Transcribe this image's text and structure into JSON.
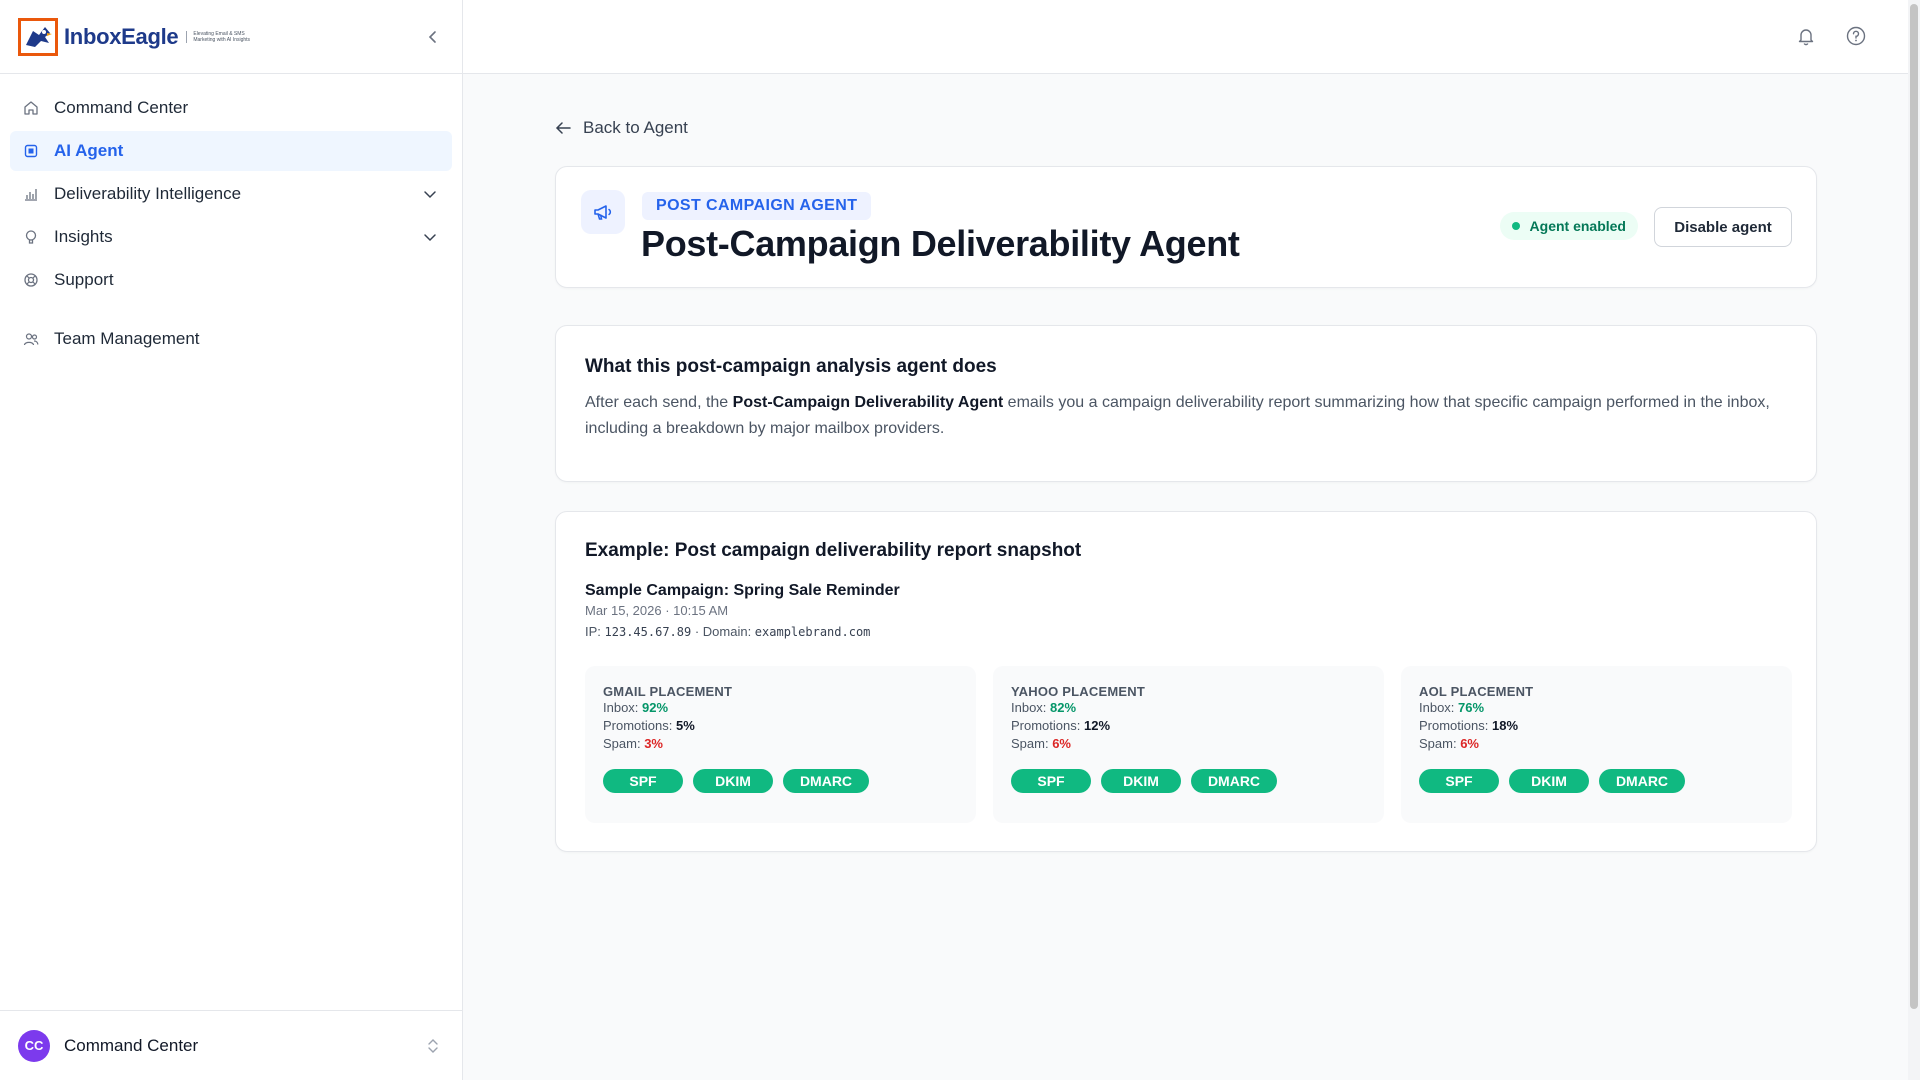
{
  "brand": {
    "name": "InboxEagle",
    "tagline": "Elevating Email & SMS Marketing with AI Insights"
  },
  "sidebar": {
    "items": [
      {
        "label": "Command Center",
        "icon": "home-icon"
      },
      {
        "label": "AI Agent",
        "icon": "chip-icon",
        "active": true
      },
      {
        "label": "Deliverability Intelligence",
        "icon": "bar-chart-icon",
        "expandable": true
      },
      {
        "label": "Insights",
        "icon": "lightbulb-icon",
        "expandable": true
      },
      {
        "label": "Support",
        "icon": "lifebuoy-icon"
      },
      {
        "label": "Team Management",
        "icon": "users-icon"
      }
    ],
    "footer": {
      "avatar_initials": "CC",
      "label": "Command Center"
    }
  },
  "main": {
    "back_label": "Back to Agent",
    "agent": {
      "tag": "POST CAMPAIGN AGENT",
      "title": "Post-Campaign Deliverability Agent",
      "status": "Agent enabled",
      "disable_label": "Disable agent"
    },
    "description": {
      "title": "What this post-campaign analysis agent does",
      "text_before": "After each send, the ",
      "text_bold": "Post-Campaign Deliverability Agent",
      "text_after": " emails you a campaign deliverability report summarizing how that specific campaign performed in the inbox, including a breakdown by major mailbox providers."
    },
    "example": {
      "title": "Example: Post campaign deliverability report snapshot",
      "campaign_name": "Sample Campaign: Spring Sale Reminder",
      "campaign_date": "Mar 15, 2026 · 10:15 AM",
      "ip_label": "IP: ",
      "ip_value": "123.45.67.89",
      "domain_label": " · Domain: ",
      "domain_value": "examplebrand.com",
      "placements": [
        {
          "title": "GMAIL PLACEMENT",
          "inbox": "92%",
          "promotions": "5%",
          "spam": "3%"
        },
        {
          "title": "YAHOO PLACEMENT",
          "inbox": "82%",
          "promotions": "12%",
          "spam": "6%"
        },
        {
          "title": "AOL PLACEMENT",
          "inbox": "76%",
          "promotions": "18%",
          "spam": "6%"
        }
      ],
      "labels": {
        "inbox": "Inbox: ",
        "promotions": "Promotions: ",
        "spam": "Spam: "
      },
      "auth_badges": [
        "SPF",
        "DKIM",
        "DMARC"
      ]
    }
  },
  "colors": {
    "accent": "#2563eb",
    "success": "#10b981",
    "danger": "#dc2626",
    "brand_orange": "#ea580c"
  }
}
